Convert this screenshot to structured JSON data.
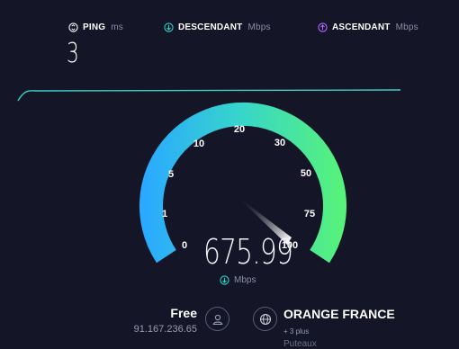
{
  "header": {
    "ping": {
      "label": "PING",
      "unit": "ms",
      "icon": "ping-icon",
      "value": "3"
    },
    "download": {
      "label": "DESCENDANT",
      "unit": "Mbps",
      "icon": "download-arrow-icon",
      "color": "#27d3c7"
    },
    "upload": {
      "label": "ASCENDANT",
      "unit": "Mbps",
      "icon": "upload-arrow-icon",
      "color": "#b06bff"
    }
  },
  "gauge": {
    "scale_labels": [
      "0",
      "1",
      "5",
      "10",
      "20",
      "30",
      "50",
      "75",
      "100"
    ],
    "current_speed": "675.99",
    "unit": "Mbps",
    "needle_fraction": 0.97,
    "colors": {
      "start": "#2aa9ff",
      "mid": "#37d6c8",
      "end": "#57f27a"
    }
  },
  "provider": {
    "name": "Free",
    "ip": "91.167.236.65",
    "icon": "user-icon"
  },
  "server": {
    "name": "ORANGE FRANCE",
    "more": "+ 3 plus",
    "location": "Puteaux",
    "icon": "globe-icon"
  }
}
